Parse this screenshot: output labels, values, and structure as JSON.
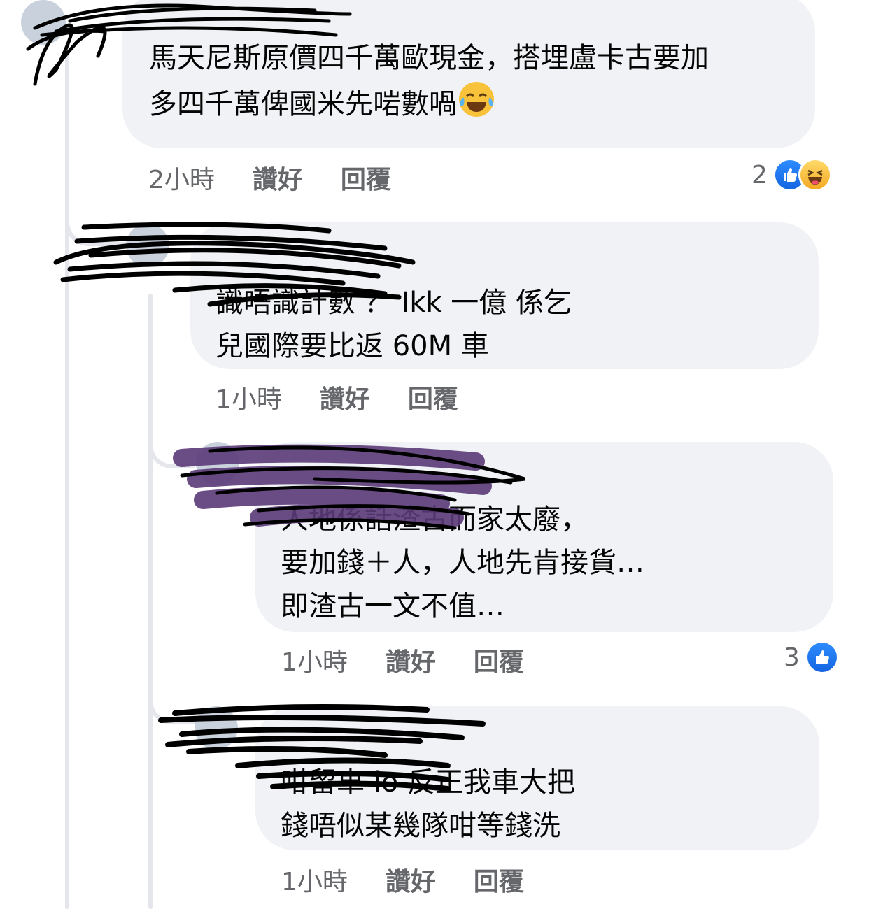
{
  "comments": [
    {
      "author": "",
      "text": "馬天尼斯原價四千萬歐現金，搭埋盧卡古要加\n多四千萬俾國米先啱數喎",
      "emoji": "tears-of-joy",
      "time": "2小時",
      "like_label": "讚好",
      "reply_label": "回覆",
      "reaction_count": "2",
      "reactions": [
        "like-icon",
        "haha-icon"
      ]
    },
    {
      "author": "",
      "mention": "",
      "text": "識唔識計數 ？ Ikk 一億 係乞\n兒國際要比返 60M 車",
      "time": "1小時",
      "like_label": "讚好",
      "reply_label": "回覆"
    },
    {
      "author": "",
      "mention": "",
      "text": "人地係話渣古而家太廢，\n要加錢＋人，人地先肯接貨…\n即渣古一文不值…",
      "time": "1小時",
      "like_label": "讚好",
      "reply_label": "回覆",
      "reaction_count": "3",
      "reactions": [
        "like-icon"
      ]
    },
    {
      "author": "",
      "mention": "",
      "text": "咁留車 lo 反正我車大把\n錢唔似某幾隊咁等錢洗",
      "time": "1小時",
      "like_label": "讚好",
      "reply_label": "回覆"
    }
  ],
  "colors": {
    "bubble": "#f0f2f5",
    "meta_text": "#65676b",
    "like_blue": "#1877f2",
    "redaction_black": "#000000",
    "redaction_purple": "#5b3a78"
  }
}
